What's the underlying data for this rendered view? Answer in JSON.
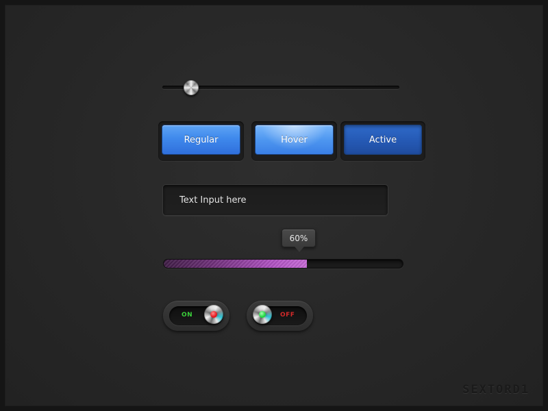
{
  "slider": {
    "value": 0.11
  },
  "buttons": [
    {
      "label": "Regular",
      "state": "regular"
    },
    {
      "label": "Hover",
      "state": "hover"
    },
    {
      "label": "Active",
      "state": "active"
    }
  ],
  "text_input": {
    "value": "Text Input here"
  },
  "progress": {
    "value": 0.6,
    "label": "60%",
    "colors": {
      "start": "#3f1d45",
      "end": "#c76bd6"
    }
  },
  "toggles": {
    "on": {
      "label": "ON",
      "state": true,
      "label_color": "#3bd13b",
      "dot_color": "#e3151b"
    },
    "off": {
      "label": "OFF",
      "state": false,
      "label_color": "#d42a2a",
      "dot_color": "#20d640"
    }
  },
  "watermark": "SEXTORD1"
}
